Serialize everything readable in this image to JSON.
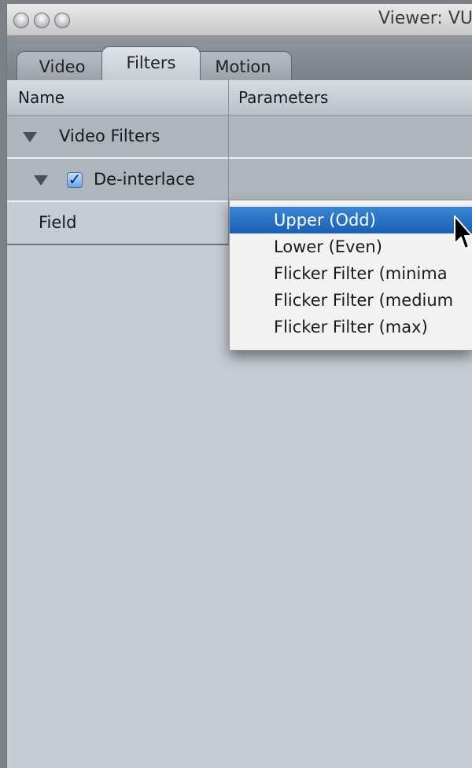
{
  "window": {
    "title": "Viewer: VU"
  },
  "tabs": [
    {
      "label": "Video",
      "active": false
    },
    {
      "label": "Filters",
      "active": true
    },
    {
      "label": "Motion",
      "active": false
    }
  ],
  "columns": {
    "name": "Name",
    "parameters": "Parameters"
  },
  "tree": {
    "group_label": "Video Filters",
    "filter_label": "De-interlace",
    "filter_enabled": true,
    "param_label": "Field"
  },
  "dropdown": {
    "selected": "Upper (Odd)",
    "options": [
      "Upper (Odd)",
      "Lower (Even)",
      "Flicker Filter (minima",
      "Flicker Filter (medium",
      "Flicker Filter (max)"
    ]
  },
  "icons": {
    "traffic_lights": [
      "close-icon",
      "minimize-icon",
      "zoom-icon"
    ],
    "disclosure": "disclosure-triangle-icon",
    "check": "checkmark-icon",
    "cursor": "arrow-cursor-icon"
  },
  "colors": {
    "selection": "#1a5fb4",
    "window_bg": "#c5ccd3",
    "row_bg": "#aeb5bc"
  }
}
